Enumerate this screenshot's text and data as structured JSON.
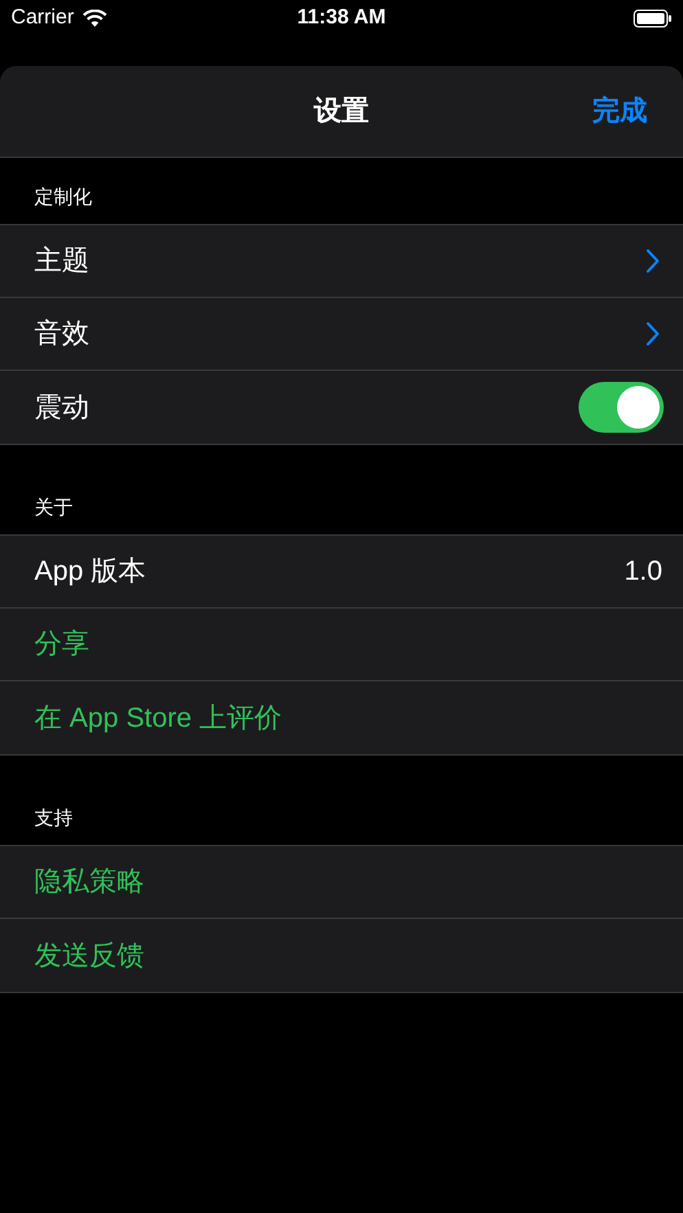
{
  "status_bar": {
    "carrier": "Carrier",
    "time": "11:38 AM"
  },
  "nav": {
    "title": "设置",
    "done": "完成"
  },
  "sections": [
    {
      "header": "定制化",
      "rows": [
        {
          "kind": "link",
          "label": "主题"
        },
        {
          "kind": "link",
          "label": "音效"
        },
        {
          "kind": "toggle",
          "label": "震动",
          "on": true
        }
      ]
    },
    {
      "header": "关于",
      "rows": [
        {
          "kind": "value",
          "label": "App 版本",
          "value": "1.0"
        },
        {
          "kind": "action",
          "label": "分享"
        },
        {
          "kind": "action",
          "label": "在 App Store 上评价"
        }
      ]
    },
    {
      "header": "支持",
      "rows": [
        {
          "kind": "action",
          "label": "隐私策略"
        },
        {
          "kind": "action",
          "label": "发送反馈"
        }
      ]
    }
  ]
}
